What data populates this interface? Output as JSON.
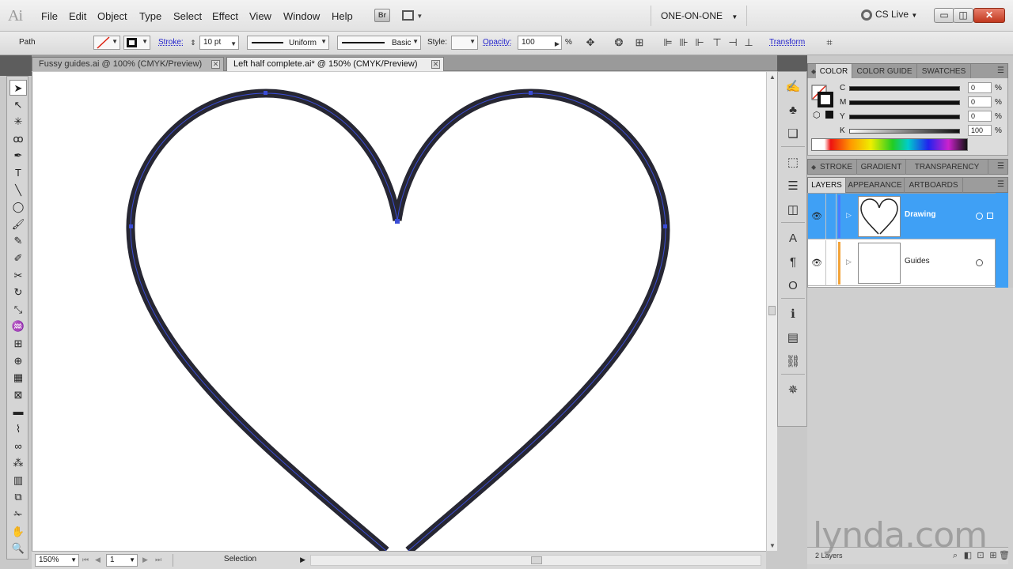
{
  "app": {
    "logo": "Ai"
  },
  "menu": [
    "File",
    "Edit",
    "Object",
    "Type",
    "Select",
    "Effect",
    "View",
    "Window",
    "Help"
  ],
  "bridge_label": "Br",
  "workspace": "ONE-ON-ONE",
  "cslive": "CS Live",
  "window_controls": {
    "minimize": "▭",
    "restore": "◫",
    "close": "✕"
  },
  "control_bar": {
    "object_type": "Path",
    "stroke_label": "Stroke:",
    "stroke_weight": "10 pt",
    "profile": "Uniform",
    "brush": "Basic",
    "style_label": "Style:",
    "opacity_label": "Opacity:",
    "opacity_value": "100",
    "opacity_unit": "%",
    "transform_label": "Transform"
  },
  "tabs": [
    {
      "title": "Fussy guides.ai @ 100% (CMYK/Preview)",
      "active": false
    },
    {
      "title": "Left half complete.ai* @ 150% (CMYK/Preview)",
      "active": true
    }
  ],
  "tools": [
    {
      "icon": "selection-tool-icon",
      "glyph": "➤",
      "selected": true
    },
    {
      "icon": "direct-selection-tool-icon",
      "glyph": "↖"
    },
    {
      "icon": "magic-wand-tool-icon",
      "glyph": "✳"
    },
    {
      "icon": "lasso-tool-icon",
      "glyph": "ꝏ"
    },
    {
      "icon": "pen-tool-icon",
      "glyph": "✒"
    },
    {
      "icon": "type-tool-icon",
      "glyph": "T"
    },
    {
      "icon": "line-tool-icon",
      "glyph": "╲"
    },
    {
      "icon": "ellipse-tool-icon",
      "glyph": "◯"
    },
    {
      "icon": "paintbrush-tool-icon",
      "glyph": "🖌"
    },
    {
      "icon": "pencil-tool-icon",
      "glyph": "✎"
    },
    {
      "icon": "blob-brush-tool-icon",
      "glyph": "✐"
    },
    {
      "icon": "scissors-tool-icon",
      "glyph": "✂"
    },
    {
      "icon": "rotate-tool-icon",
      "glyph": "↻"
    },
    {
      "icon": "scale-tool-icon",
      "glyph": "⤡"
    },
    {
      "icon": "warp-tool-icon",
      "glyph": "♒"
    },
    {
      "icon": "free-transform-tool-icon",
      "glyph": "⊞"
    },
    {
      "icon": "shape-builder-tool-icon",
      "glyph": "⊕"
    },
    {
      "icon": "perspective-grid-tool-icon",
      "glyph": "▦"
    },
    {
      "icon": "mesh-tool-icon",
      "glyph": "⊠"
    },
    {
      "icon": "gradient-tool-icon",
      "glyph": "▬"
    },
    {
      "icon": "eyedropper-tool-icon",
      "glyph": "⌇"
    },
    {
      "icon": "blend-tool-icon",
      "glyph": "∞"
    },
    {
      "icon": "symbol-sprayer-tool-icon",
      "glyph": "⁂"
    },
    {
      "icon": "graph-tool-icon",
      "glyph": "▥"
    },
    {
      "icon": "artboard-tool-icon",
      "glyph": "⧉"
    },
    {
      "icon": "slice-tool-icon",
      "glyph": "✁"
    },
    {
      "icon": "hand-tool-icon",
      "glyph": "✋"
    },
    {
      "icon": "zoom-tool-icon",
      "glyph": "🔍"
    }
  ],
  "dock": [
    {
      "icon": "brushes-icon",
      "glyph": "✍"
    },
    {
      "icon": "symbols-icon",
      "glyph": "♣"
    },
    {
      "icon": "graphic-styles-icon",
      "glyph": "❑"
    },
    {
      "icon": "transform-icon",
      "glyph": "⬚"
    },
    {
      "icon": "align-icon",
      "glyph": "☰"
    },
    {
      "icon": "pathfinder-icon",
      "glyph": "◫"
    },
    {
      "icon": "character-icon",
      "glyph": "A"
    },
    {
      "icon": "paragraph-icon",
      "glyph": "¶"
    },
    {
      "icon": "opentype-icon",
      "glyph": "O"
    },
    {
      "icon": "info-icon",
      "glyph": "ℹ"
    },
    {
      "icon": "document-info-icon",
      "glyph": "▤"
    },
    {
      "icon": "links-icon",
      "glyph": "⛓"
    },
    {
      "icon": "navigator-icon",
      "glyph": "✵"
    }
  ],
  "color_panel": {
    "tabs": [
      "COLOR",
      "COLOR GUIDE",
      "SWATCHES"
    ],
    "channels": [
      {
        "name": "C",
        "value": "0",
        "fill": 0
      },
      {
        "name": "M",
        "value": "0",
        "fill": 0
      },
      {
        "name": "Y",
        "value": "0",
        "fill": 0
      },
      {
        "name": "K",
        "value": "100",
        "fill": 1
      }
    ],
    "unit": "%"
  },
  "stroke_panel_tabs": [
    "STROKE",
    "GRADIENT",
    "TRANSPARENCY"
  ],
  "layers_panel": {
    "tabs": [
      "LAYERS",
      "APPEARANCE",
      "ARTBOARDS"
    ],
    "layers": [
      {
        "name": "Drawing",
        "color": "#4a7cff",
        "selected": true
      },
      {
        "name": "Guides",
        "color": "#f2a33a",
        "selected": false
      }
    ],
    "count": "2 Layers"
  },
  "status": {
    "zoom": "150%",
    "artboard": "1",
    "tool": "Selection"
  },
  "watermark": "lynda.com",
  "colors": {
    "accent": "#3fa0f5",
    "stroke": "#272733",
    "path_highlight": "#3a4cd6"
  }
}
